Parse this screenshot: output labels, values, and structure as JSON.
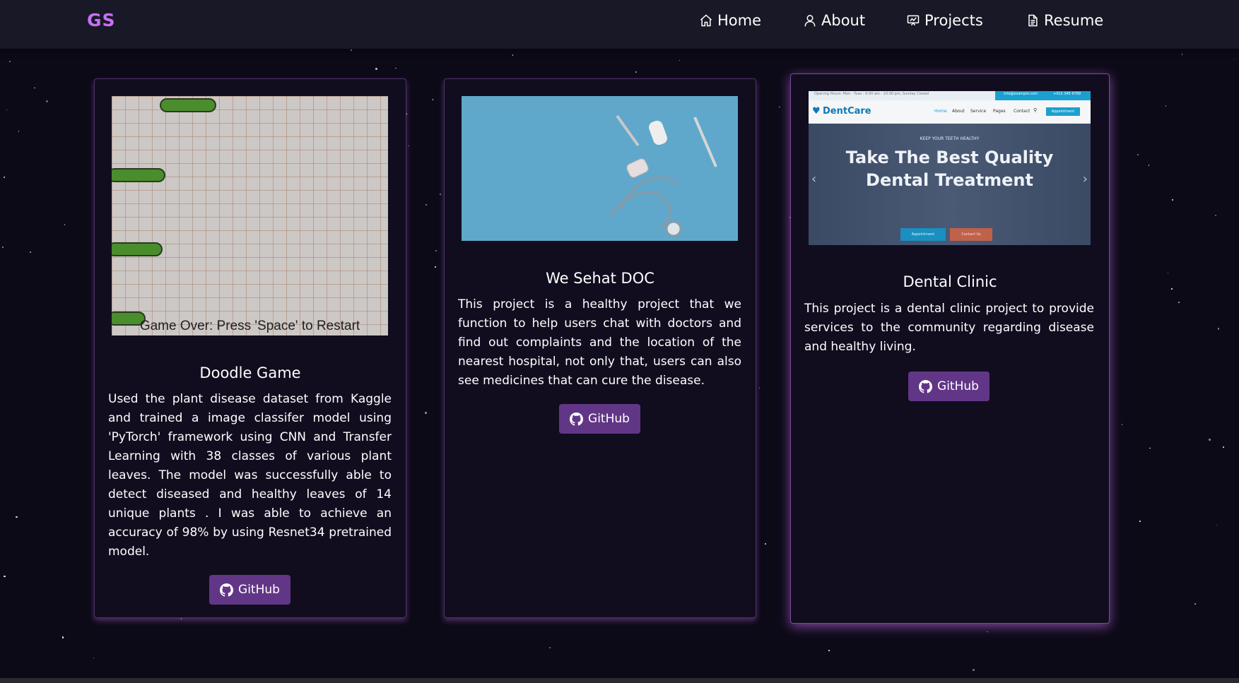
{
  "navbar": {
    "logo": "GS",
    "items": [
      {
        "label": "Home",
        "icon": "home-icon"
      },
      {
        "label": "About",
        "icon": "user-icon"
      },
      {
        "label": "Projects",
        "icon": "projects-icon"
      },
      {
        "label": "Resume",
        "icon": "document-icon"
      }
    ]
  },
  "projects": [
    {
      "title": "Doodle Game",
      "image_caption": "Game Over: Press 'Space' to Restart",
      "description": "Used the plant disease dataset from Kaggle and trained a image classifer model using 'PyTorch' framework using CNN and Transfer Learning with 38 classes of various plant leaves. The model was successfully able to detect diseased and healthy leaves of 14 unique plants . I was able to achieve an accuracy of 98% by using Resnet34 pretrained model.",
      "button_label": "GitHub"
    },
    {
      "title": "We Sehat DOC",
      "description": "This project is a healthy project that we function to help users chat with doctors and find out complaints and the location of the nearest hospital, not only that, users can also see medicines that can cure the disease.",
      "button_label": "GitHub"
    },
    {
      "title": "Dental Clinic",
      "image_preview": {
        "brand": "DentCare",
        "topbar_hours": "Opening Hours: Mon - Tues : 6.00 am - 10.00 pm, Sunday Closed",
        "topbar_email": "info@example.com",
        "topbar_phone": "+012 345 6789",
        "menu": [
          "Home",
          "About",
          "Service",
          "Pages",
          "Contact"
        ],
        "appointment": "Appointment",
        "kicker": "KEEP YOUR TEETH HEALTHY",
        "headline_line1": "Take The Best Quality",
        "headline_line2": "Dental Treatment",
        "btn_appointment": "Appointment",
        "btn_contact": "Contact Us"
      },
      "description": "This project is a dental clinic project to provide services to the community regarding disease and healthy living.",
      "button_label": "GitHub"
    }
  ],
  "colors": {
    "background": "#0d0a18",
    "navbar": "#181826",
    "accent": "#c770f0",
    "button": "#623686"
  }
}
